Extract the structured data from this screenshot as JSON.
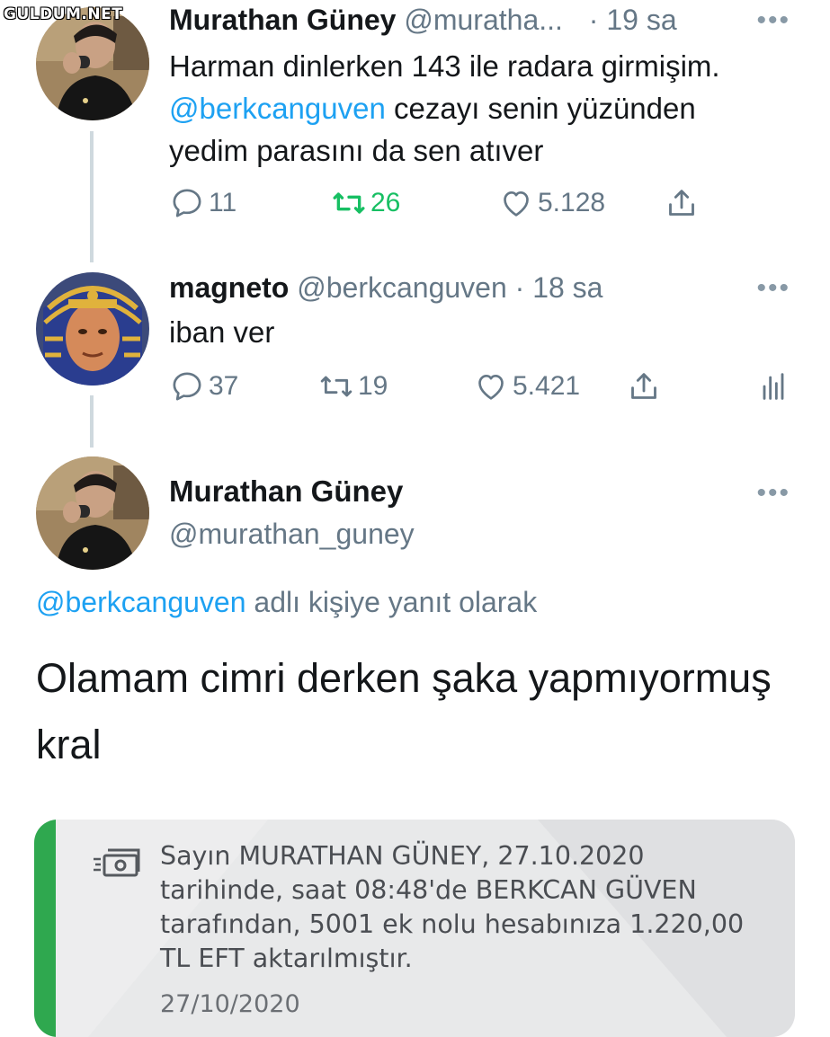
{
  "watermark": "GULDUM.NET",
  "tweet1": {
    "name": "Murathan Güney",
    "handle": "@muratha...",
    "dot": "·",
    "time": "19 sa",
    "text_part1": "Harman dinlerken 143 ile radara girmişim.",
    "mention": "@berkcanguven",
    "text_part2": "cezayı senin yüzünden yedim parasını da sen atıver",
    "replies": "11",
    "retweets": "26",
    "likes": "5.128"
  },
  "tweet2": {
    "name": "magneto",
    "handle": "@berkcanguven",
    "dot": "·",
    "time": "18 sa",
    "text": "iban ver",
    "replies": "37",
    "retweets": "19",
    "likes": "5.421"
  },
  "tweet3": {
    "name": "Murathan Güney",
    "handle": "@murathan_guney",
    "reply_mention": "@berkcanguven",
    "reply_suffix": "adlı kişiye yanıt olarak",
    "text": "Olamam cimri derken şaka yapmıyormuş kral"
  },
  "sms": {
    "line1": "Sayın MURATHAN GÜNEY, 27.10.2020",
    "line2": "tarihinde, saat 08:48'de BERKCAN GÜVEN",
    "line3": "tarafından, 5001 ek nolu hesabınıza 1.220,00",
    "line4": "TL EFT aktarılmıştır.",
    "date": "27/10/2020"
  },
  "colors": {
    "accent": "#1da1f2",
    "retweet_active": "#17bf63",
    "muted": "#657786",
    "sms_bar": "#2fa84f"
  },
  "icons": [
    "reply-icon",
    "retweet-icon",
    "like-icon",
    "share-icon",
    "analytics-icon",
    "more-icon",
    "money-icon"
  ]
}
